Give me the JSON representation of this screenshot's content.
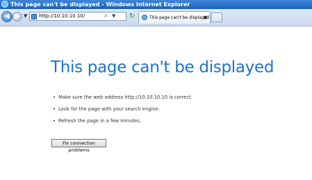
{
  "window": {
    "title": "This page can't be displayed - Windows Internet Explorer"
  },
  "toolbar": {
    "back_icon": "back-arrow-icon",
    "forward_icon": "forward-arrow-icon",
    "address": "http://10.10.10.10/",
    "refresh_icon": "refresh-icon",
    "tab_label": "This page can't be displayed",
    "close_symbol": "✖"
  },
  "content": {
    "heading": "This page can't be displayed",
    "tips": [
      "Make sure the web address http://10.10.10.10 is correct.",
      "Look for the page with your search engine.",
      "Refresh the page in a few minutes."
    ],
    "fix_button": "Fix connection problems"
  },
  "colors": {
    "heading": "#1e73c7",
    "titlebar": "#1c5fb8",
    "background": "#ffffff"
  }
}
